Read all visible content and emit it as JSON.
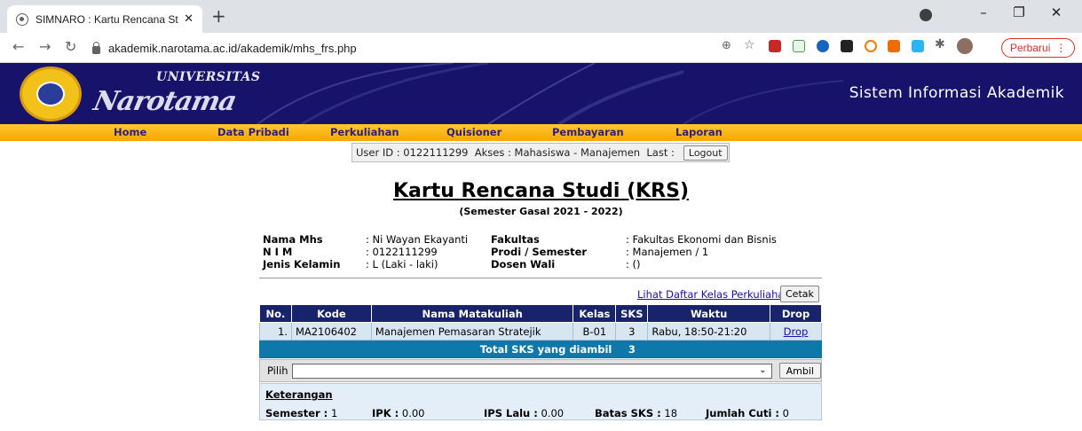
{
  "browser": {
    "tab_title": "SIMNARO : Kartu Rencana Studi",
    "url": "akademik.narotama.ac.id/akademik/mhs_frs.php",
    "update_label": "Perbarui"
  },
  "header": {
    "logo_top": "UNIVERSITAS",
    "logo_brand": "Narotama",
    "system_title": "Sistem Informasi Akademik"
  },
  "nav": {
    "items": [
      "Home",
      "Data Pribadi",
      "Perkuliahan",
      "Quisioner",
      "Pembayaran",
      "Laporan"
    ]
  },
  "userbar": {
    "text": "User ID : 0122111299  Akses : Mahasiswa - Manajemen  Last :",
    "logout_label": "Logout"
  },
  "page": {
    "title": "Kartu Rencana Studi (KRS)",
    "semester": "(Semester Gasal 2021 - 2022)"
  },
  "student": {
    "nama_label": "Nama Mhs",
    "nama_value": ": Ni Wayan Ekayanti",
    "nim_label": "N I M",
    "nim_value": ": 0122111299",
    "jk_label": "Jenis Kelamin",
    "jk_value": ": L (Laki - laki)",
    "fakultas_label": "Fakultas",
    "fakultas_value": ": Fakultas Ekonomi dan Bisnis",
    "prodi_label": "Prodi / Semester",
    "prodi_value": ": Manajemen / 1",
    "dosen_label": "Dosen Wali",
    "dosen_value": ": ()"
  },
  "actions": {
    "lihat_label": "Lihat Daftar Kelas Perkuliahan",
    "cetak_label": "Cetak"
  },
  "table": {
    "headers": [
      "No.",
      "Kode",
      "Nama Matakuliah",
      "Kelas",
      "SKS",
      "Waktu",
      "Drop"
    ],
    "rows": [
      {
        "no": "1.",
        "kode": "MA2106402",
        "nama": "Manajemen Pemasaran Stratejik",
        "kelas": "B-01",
        "sks": "3",
        "waktu": "Rabu, 18:50-21:20",
        "drop": "Drop"
      }
    ],
    "total_label": "Total SKS yang diambil",
    "total_value": "3"
  },
  "pilih": {
    "label": "Pilih",
    "ambil_label": "Ambil"
  },
  "keterangan": {
    "title": "Keterangan",
    "semester_label": "Semester :",
    "semester_value": "1",
    "ipk_label": "IPK :",
    "ipk_value": "0.00",
    "ips_label": "IPS Lalu :",
    "ips_value": "0.00",
    "batas_label": "Batas SKS :",
    "batas_value": "18",
    "cuti_label": "Jumlah Cuti :",
    "cuti_value": "0"
  }
}
